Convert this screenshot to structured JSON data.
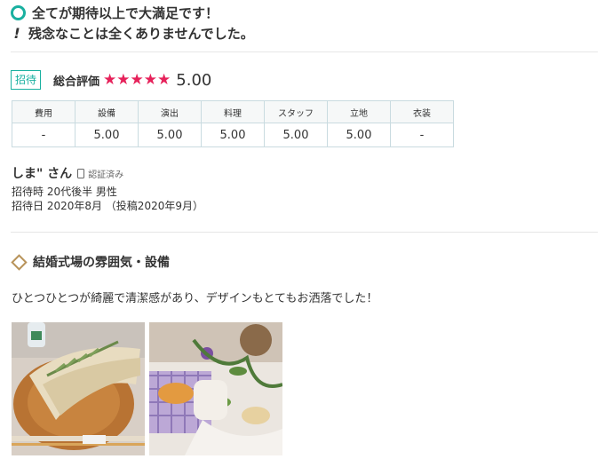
{
  "headline": {
    "good": "全てが期待以上で大満足です！",
    "bad": "残念なことは全くありませんでした。"
  },
  "rating": {
    "badge": "招待",
    "overall_label": "総合評価",
    "stars": 5,
    "score": "5.00",
    "star_color": "#e6215a"
  },
  "scores": {
    "headers": [
      "費用",
      "設備",
      "演出",
      "料理",
      "スタッフ",
      "立地",
      "衣装"
    ],
    "values": [
      "-",
      "5.00",
      "5.00",
      "5.00",
      "5.00",
      "5.00",
      "-"
    ]
  },
  "reviewer": {
    "name": "しま\" さん",
    "verified": "認証済み",
    "info1": "招待時 20代後半 男性",
    "info2": "招待日 2020年8月 （投稿2020年9月）"
  },
  "section": {
    "title": "結婚式場の雰囲気・設備",
    "body": "ひとつひとつが綺麗で清潔感があり、デザインもとてもお洒落でした！"
  },
  "colors": {
    "accent": "#19b0a0",
    "section_icon": "#b8935a"
  },
  "icons": [
    "circle-icon",
    "exclamation-icon",
    "star-icon",
    "phone-icon",
    "diamond-icon"
  ]
}
